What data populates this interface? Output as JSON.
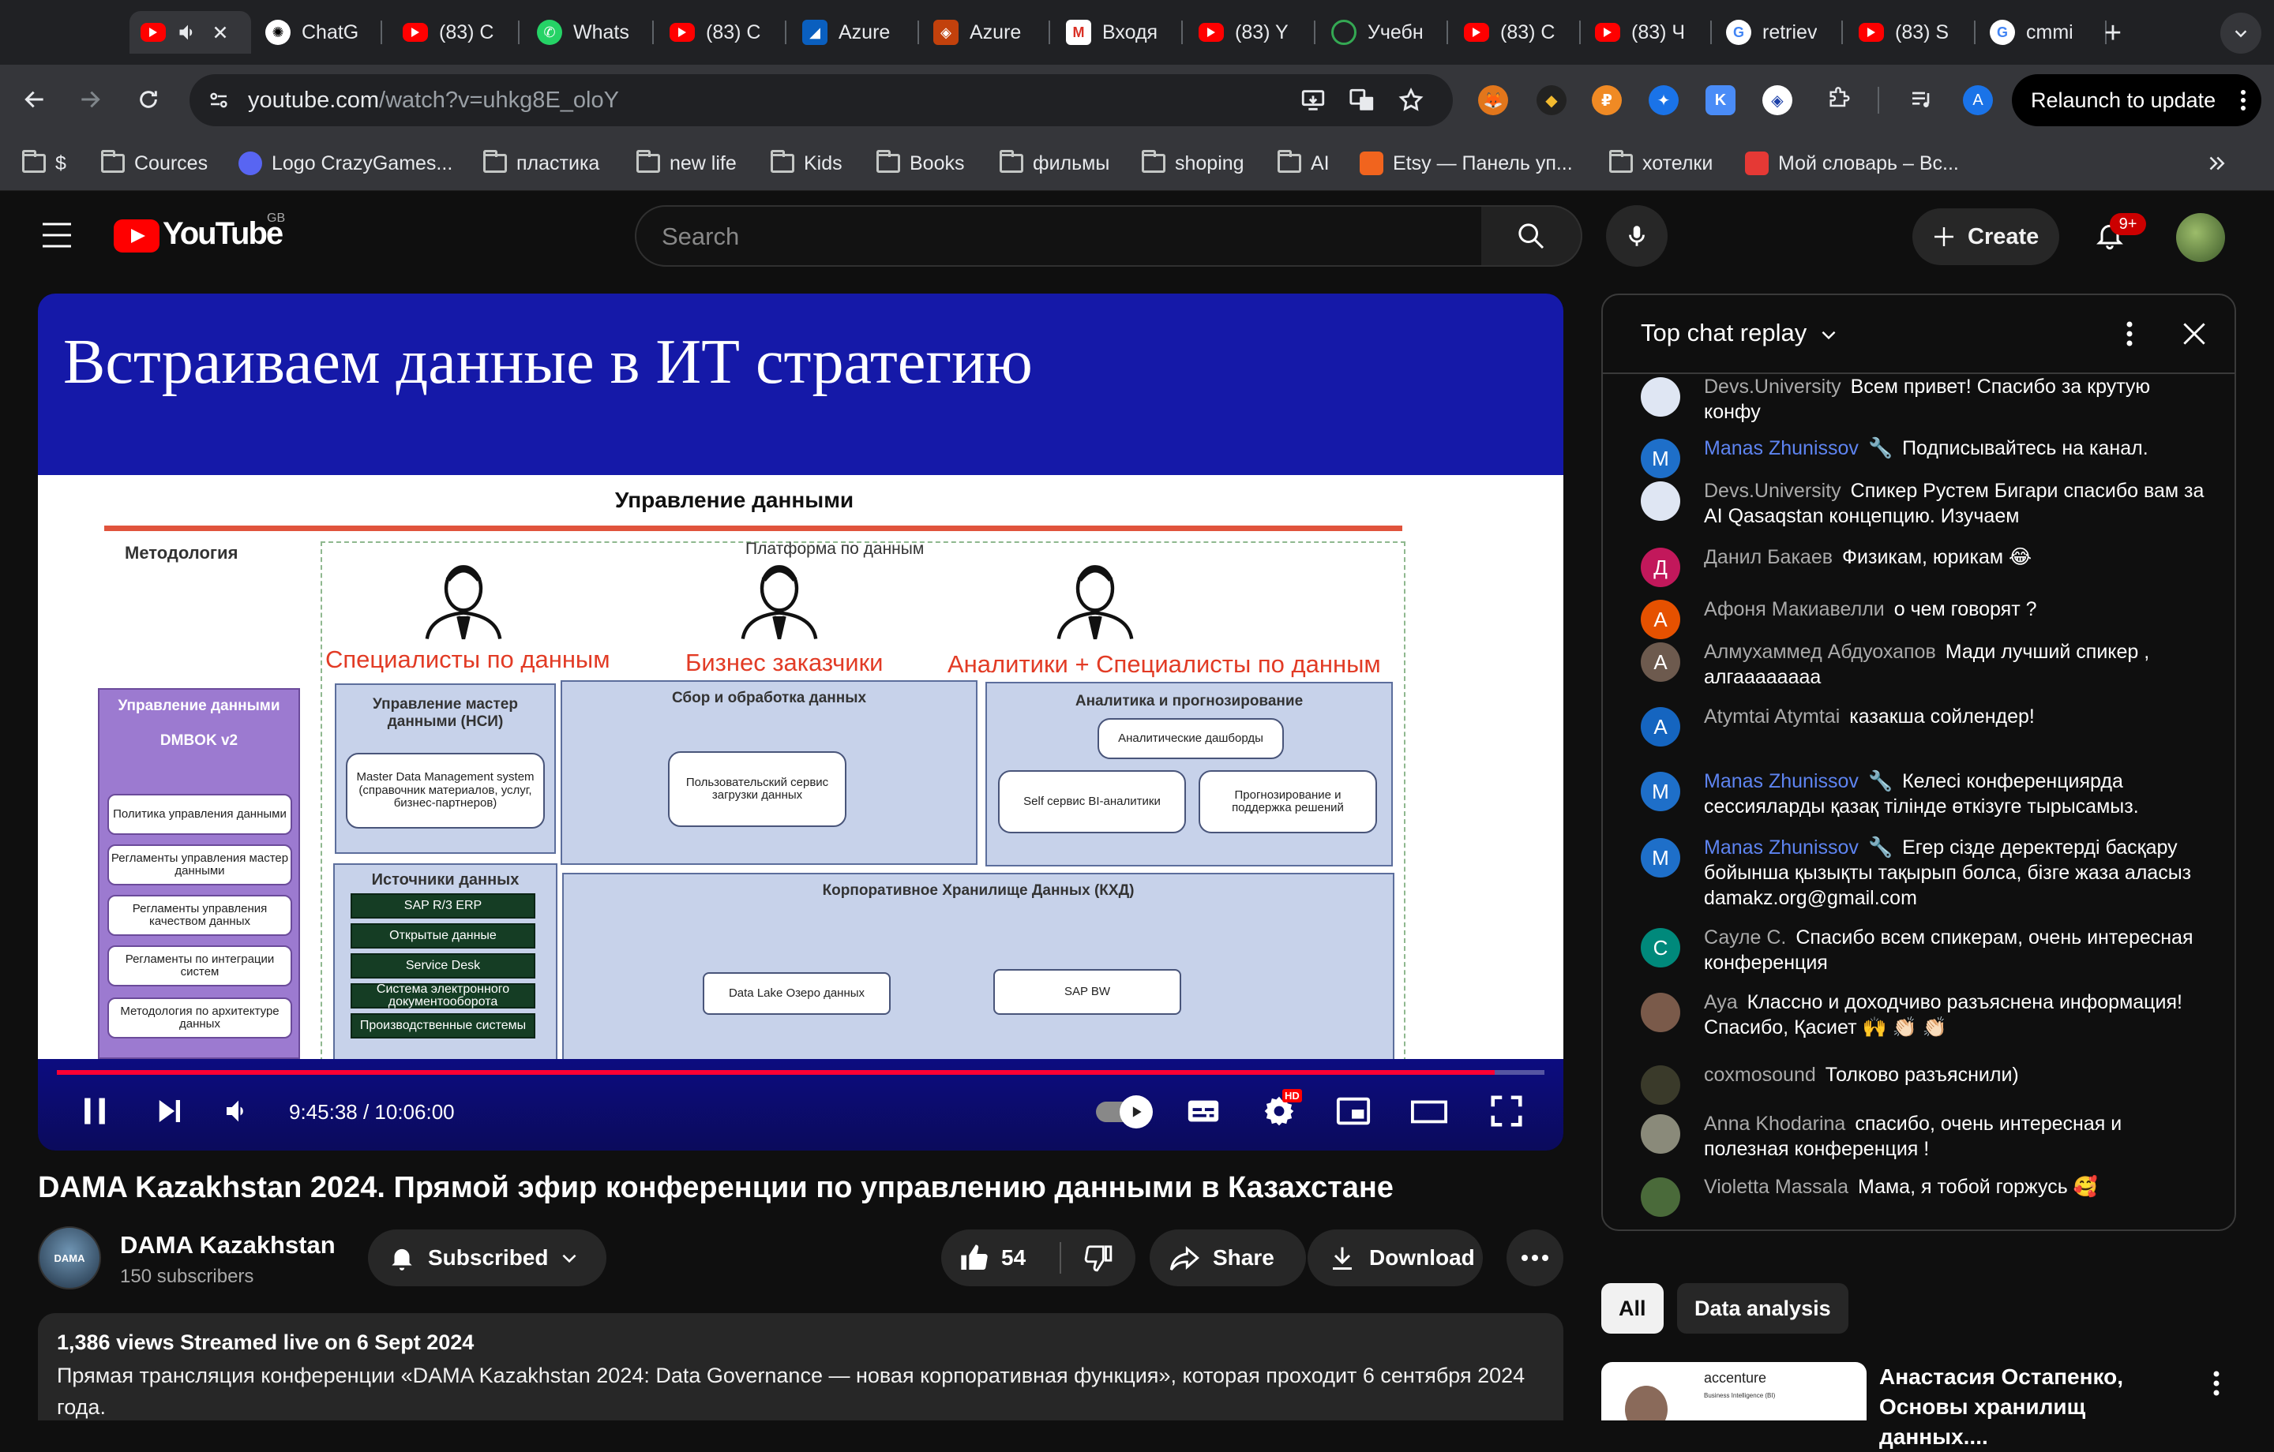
{
  "browser": {
    "tabs": [
      {
        "title": "",
        "icon": "youtube-icon",
        "active": true
      },
      {
        "title": "ChatG",
        "icon": "chatgpt-icon"
      },
      {
        "title": "(83) C",
        "icon": "youtube-icon"
      },
      {
        "title": "Whats",
        "icon": "whatsapp-icon"
      },
      {
        "title": "(83) C",
        "icon": "youtube-icon"
      },
      {
        "title": "Azure",
        "icon": "azure-icon"
      },
      {
        "title": "Azure",
        "icon": "azure-stack-icon"
      },
      {
        "title": "Входя",
        "icon": "gmail-icon"
      },
      {
        "title": "(83) Y",
        "icon": "youtube-icon"
      },
      {
        "title": "Учебн",
        "icon": "loading-icon"
      },
      {
        "title": "(83) C",
        "icon": "youtube-icon"
      },
      {
        "title": "(83) Ч",
        "icon": "youtube-icon"
      },
      {
        "title": "retriev",
        "icon": "google-icon"
      },
      {
        "title": "(83) S",
        "icon": "youtube-icon"
      },
      {
        "title": "cmmi",
        "icon": "google-icon"
      }
    ],
    "url_host": "youtube.com",
    "url_path": "/watch?v=uhkg8E_oloY",
    "relaunch_label": "Relaunch to update",
    "profile_initial": "A",
    "extension_initial": "K",
    "bookmarks": [
      {
        "label": "$",
        "type": "folder"
      },
      {
        "label": "Cources",
        "type": "folder"
      },
      {
        "label": "Logo CrazyGames...",
        "type": "site"
      },
      {
        "label": "пластика",
        "type": "folder"
      },
      {
        "label": "new life",
        "type": "folder"
      },
      {
        "label": "Kids",
        "type": "folder"
      },
      {
        "label": "Books",
        "type": "folder"
      },
      {
        "label": "фильмы",
        "type": "folder"
      },
      {
        "label": "shoping",
        "type": "folder"
      },
      {
        "label": "AI",
        "type": "folder"
      },
      {
        "label": "Etsy — Панель уп...",
        "type": "site"
      },
      {
        "label": "хотелки",
        "type": "folder"
      },
      {
        "label": "Мой словарь – Вс...",
        "type": "site"
      }
    ]
  },
  "youtube": {
    "logo_text": "YouTube",
    "country": "GB",
    "search_placeholder": "Search",
    "create_label": "Create",
    "notif_badge": "9+"
  },
  "slide": {
    "title": "Встраиваем данные в ИТ стратегию",
    "heading": "Управление данными",
    "methodology": "Методология",
    "platform": "Платформа по данным",
    "roles": [
      "Специалисты по данным",
      "Бизнес заказчики",
      "Аналитики + Специалисты по данным"
    ],
    "dmbok_title": "Управление данными",
    "dmbok_sub": "DMBOK v2",
    "dmbok_items": [
      "Политика управления данными",
      "Регламенты управления мастер данными",
      "Регламенты управления качеством данных",
      "Регламенты по интеграции систем",
      "Методология по архитектуре данных"
    ],
    "mdm_title": "Управление мастер данными (НСИ)",
    "mdm_item": "Master Data Management system (справочник материалов, услуг, бизнес-партнеров)",
    "collect_title": "Сбор и обработка данных",
    "collect_item": "Пользовательский сервис загрузки данных",
    "analytics_title": "Аналитика и прогнозирование",
    "analytics_items": [
      "Аналитические дашборды",
      "Self сервис BI-аналитики",
      "Прогнозирование и поддержка решений"
    ],
    "sources_title": "Источники данных",
    "sources": [
      "SAP R/3 ERP",
      "Открытые данные",
      "Service Desk",
      "Система электронного документооборота",
      "Производственные системы"
    ],
    "dwh_title": "Корпоративное Хранилище Данных (КХД)",
    "dwh_items": [
      "Data Lake Озеро данных",
      "SAP BW"
    ]
  },
  "player": {
    "time": "9:45:38 / 10:06:00",
    "progress": 0.9667,
    "settings_badge": "HD"
  },
  "video": {
    "title": "DAMA Kazakhstan 2024. Прямой эфир конференции по управлению данными в Казахстане",
    "channel_name": "DAMA Kazakhstan",
    "channel_avatar_text": "DAMA",
    "subscribers": "150 subscribers",
    "subscribed_label": "Subscribed",
    "likes": "54",
    "share_label": "Share",
    "download_label": "Download",
    "stats": "1,386 views  Streamed live on 6 Sept 2024",
    "description": "Прямая трансляция конференции «DAMA Kazakhstan 2024: Data Governance — новая корпоративная функция», которая проходит 6 сентября 2024 года."
  },
  "chat": {
    "title": "Top chat replay",
    "messages": [
      {
        "author": "Devs.University",
        "text": "Всем привет! Спасибо за крутую конфу",
        "initial": "",
        "color": "#dfe6f3",
        "mod": false
      },
      {
        "author": "Manas Zhunissov",
        "text": "Подписывайтесь на канал.",
        "initial": "M",
        "color": "#1e6fc9",
        "mod": true
      },
      {
        "author": "Devs.University",
        "text": "Спикер Рустем Бигари спасибо вам за AI Qasaqstan концепцию. Изучаем",
        "initial": "",
        "color": "#dfe6f3",
        "mod": false
      },
      {
        "author": "Данил Бакаев",
        "text": "Физикам, юрикам 😂",
        "initial": "Д",
        "color": "#c2185b",
        "mod": false
      },
      {
        "author": "Афоня Макиавелли",
        "text": "о чем говорят ?",
        "initial": "А",
        "color": "#e65100",
        "mod": false
      },
      {
        "author": "Алмухаммед Абдуохапов",
        "text": "Мади лучший спикер , алгаааааааа",
        "initial": "А",
        "color": "#6d5a4e",
        "mod": false
      },
      {
        "author": "Atymtai Atymtai",
        "text": "казакша сойлендер!",
        "initial": "A",
        "color": "#1565c0",
        "mod": false
      },
      {
        "author": "Manas Zhunissov",
        "text": "Келесі конференциярда сессияларды қазақ тілінде өткізуге тырысамыз.",
        "initial": "M",
        "color": "#1e6fc9",
        "mod": true
      },
      {
        "author": "Manas Zhunissov",
        "text": "Егер сізде деректерді басқару бойынша қызықты тақырып болса, бізге жаза аласыз damakz.org@gmail.com",
        "initial": "M",
        "color": "#1e6fc9",
        "mod": true
      },
      {
        "author": "Сауле С.",
        "text": "Спасибо всем спикерам, очень интересная конференция",
        "initial": "С",
        "color": "#00897b",
        "mod": false
      },
      {
        "author": "Aya",
        "text": "Классно и доходчиво разъяснена информация! Спасибо, Қасиет 🙌 👏🏻 👏🏻",
        "initial": "",
        "color": "#7a5a4a",
        "mod": false
      },
      {
        "author": "coxmosound",
        "text": "Толково разъяснили)",
        "initial": "",
        "color": "#3a3a2a",
        "mod": false
      },
      {
        "author": "Anna Khodarina",
        "text": "спасибо, очень интересная и полезная конференция !",
        "initial": "",
        "color": "#8a8a7a",
        "mod": false
      },
      {
        "author": "Violetta Massala",
        "text": "Мама, я тобой горжусь 🥰",
        "initial": "",
        "color": "#4a6a3a",
        "mod": false
      }
    ],
    "chips": [
      "All",
      "Data analysis"
    ],
    "rec_title": "Анастасия Остапенко, Основы хранилищ данных....",
    "rec_thumb_text": "accenture",
    "rec_thumb_caption": "Business Intelligence (BI)"
  }
}
